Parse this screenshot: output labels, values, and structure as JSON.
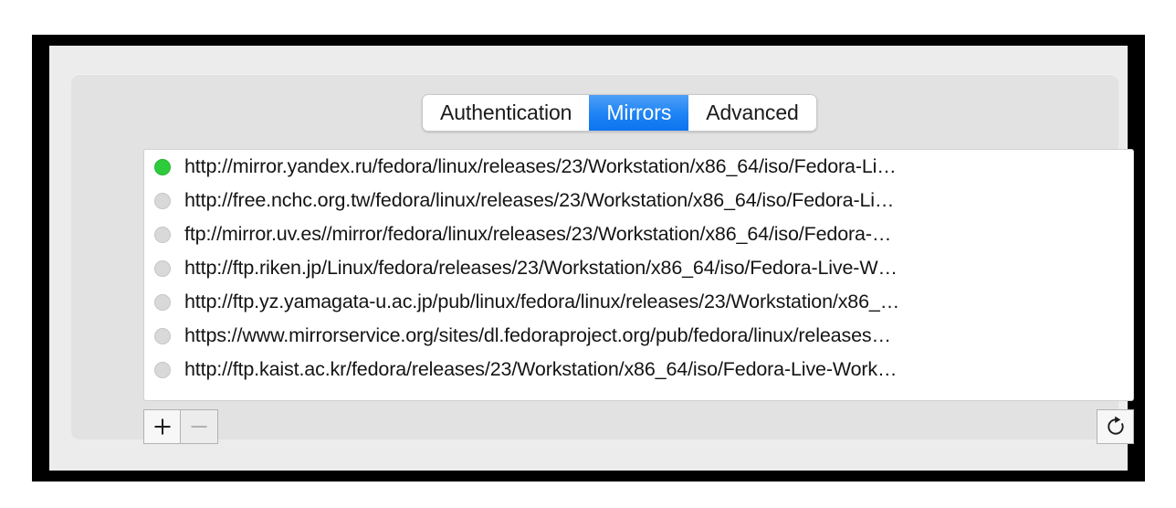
{
  "window": {
    "tabs": [
      {
        "label": "Authentication",
        "active": false,
        "name": "tab-authentication"
      },
      {
        "label": "Mirrors",
        "active": true,
        "name": "tab-mirrors"
      },
      {
        "label": "Advanced",
        "active": false,
        "name": "tab-advanced"
      }
    ]
  },
  "mirrors": {
    "rows": [
      {
        "status": "online",
        "url": "http://mirror.yandex.ru/fedora/linux/releases/23/Workstation/x86_64/iso/Fedora-Li…"
      },
      {
        "status": "offline",
        "url": "http://free.nchc.org.tw/fedora/linux/releases/23/Workstation/x86_64/iso/Fedora-Li…"
      },
      {
        "status": "offline",
        "url": "ftp://mirror.uv.es//mirror/fedora/linux/releases/23/Workstation/x86_64/iso/Fedora-…"
      },
      {
        "status": "offline",
        "url": "http://ftp.riken.jp/Linux/fedora/releases/23/Workstation/x86_64/iso/Fedora-Live-W…"
      },
      {
        "status": "offline",
        "url": "http://ftp.yz.yamagata-u.ac.jp/pub/linux/fedora/linux/releases/23/Workstation/x86_…"
      },
      {
        "status": "offline",
        "url": "https://www.mirrorservice.org/sites/dl.fedoraproject.org/pub/fedora/linux/releases…"
      },
      {
        "status": "offline",
        "url": "http://ftp.kaist.ac.kr/fedora/releases/23/Workstation/x86_64/iso/Fedora-Live-Work…"
      }
    ]
  },
  "toolbar": {
    "add_label": "+",
    "remove_label": "−",
    "add_icon": "plus-icon",
    "remove_icon": "minus-icon",
    "refresh_icon": "refresh-icon"
  },
  "colors": {
    "accent_blue": "#1f84f4",
    "status_online_green": "#2ecb3a",
    "status_offline_gray": "#d9d9d9",
    "panel_gray": "#e2e2e2",
    "chrome_gray": "#ececec",
    "frame_black": "#000000"
  }
}
